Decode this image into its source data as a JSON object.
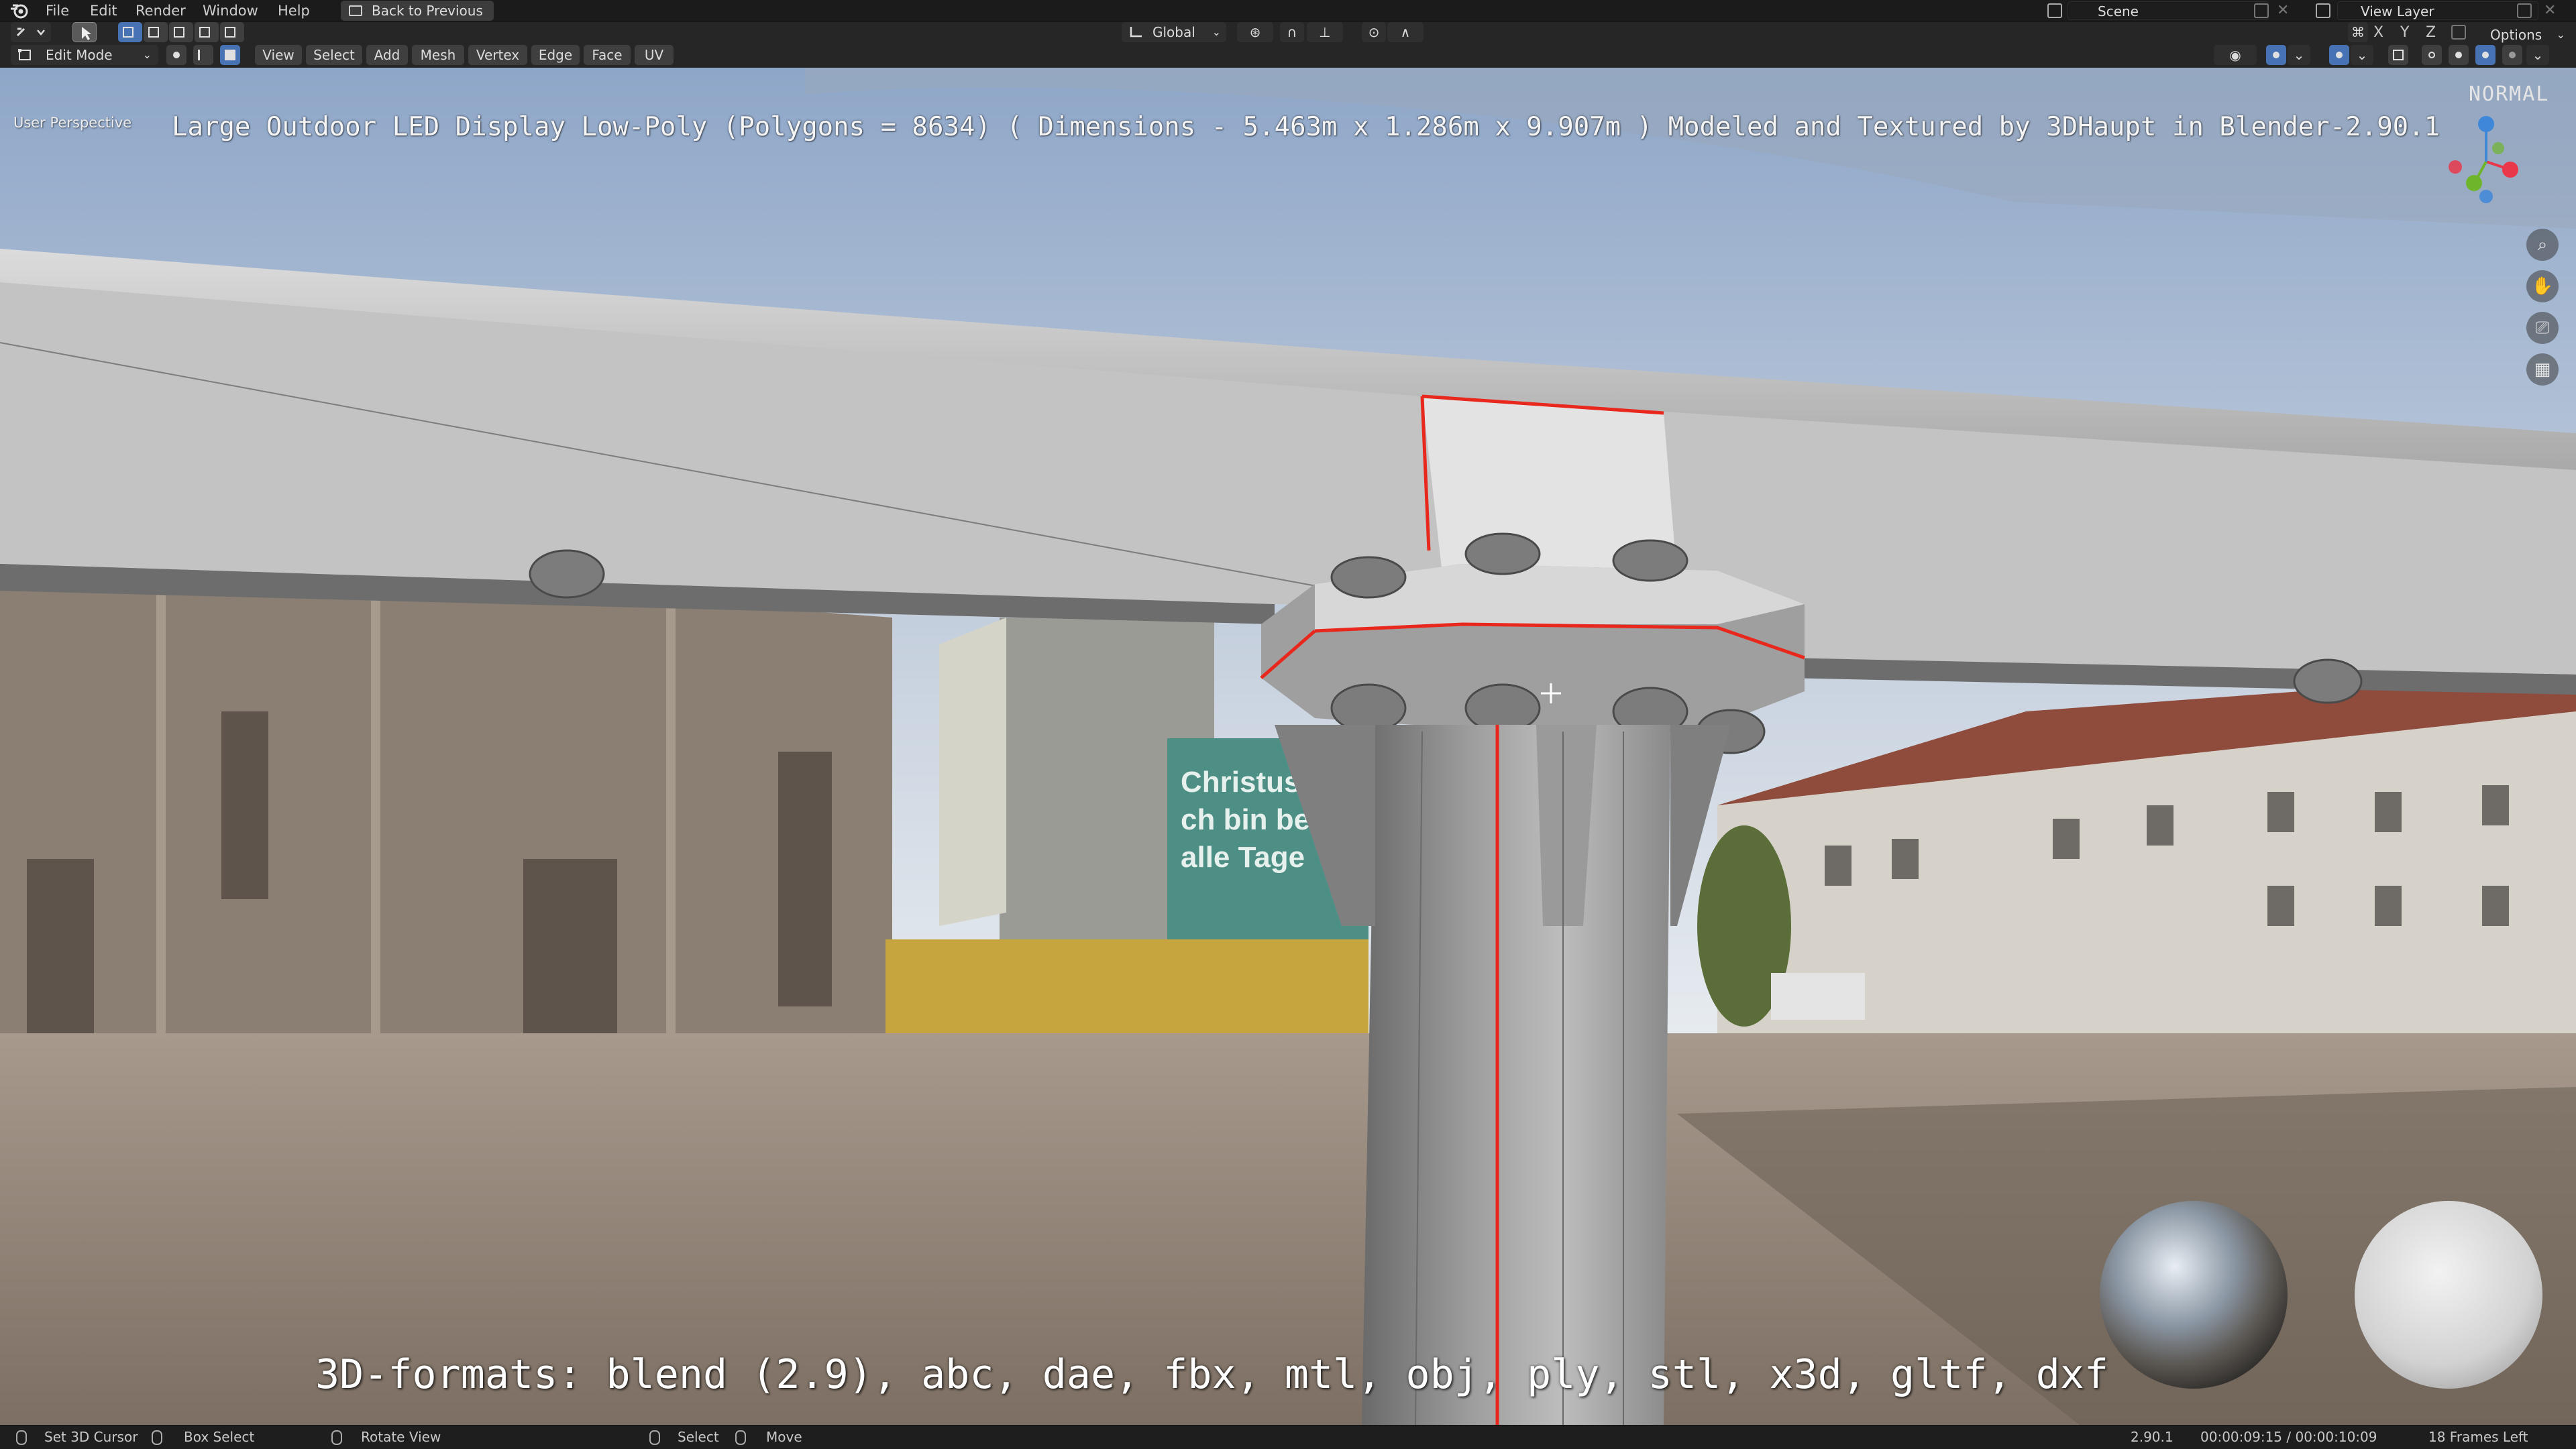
{
  "menu": {
    "items": [
      "File",
      "Edit",
      "Render",
      "Window",
      "Help"
    ],
    "back_button": "Back to Previous",
    "scene": "Scene",
    "view_layer": "View Layer"
  },
  "header": {
    "mode": "Edit Mode",
    "menus": [
      "View",
      "Select",
      "Add",
      "Mesh",
      "Vertex",
      "Edge",
      "Face",
      "UV"
    ],
    "transform_orientation": "Global",
    "options_label": "Options",
    "axes": [
      "X",
      "Y",
      "Z"
    ]
  },
  "viewport": {
    "perspective_label": "User Perspective",
    "title_overlay": "Large Outdoor LED Display Low-Poly (Polygons = 8634) ( Dimensions -  5.463m x 1.286m x 9.907m ) Modeled and Textured by 3DHaupt in Blender-2.90.1",
    "formats_overlay": "3D-formats: blend (2.9), abc, dae, fbx, mtl, obj, ply, stl, x3d, gltf, dxf",
    "corner_label": "NORMAL",
    "banner_text": "Christus\nch bin bei\nalle Tage",
    "nav_buttons": [
      "zoom-icon",
      "pan-hand-icon",
      "camera-icon",
      "grid-icon"
    ],
    "colors": {
      "selected_edge": "#e8281d",
      "axis_x": "#e8384a",
      "axis_y": "#6fb52c",
      "axis_z": "#3f87d8"
    }
  },
  "status": {
    "left": [
      "Set 3D Cursor",
      "Box Select",
      "Rotate View"
    ],
    "middle": [
      "Select",
      "Move"
    ],
    "version": "2.90.1",
    "time": "00:00:09:15 / 00:00:10:09",
    "frames": "18 Frames Left"
  }
}
